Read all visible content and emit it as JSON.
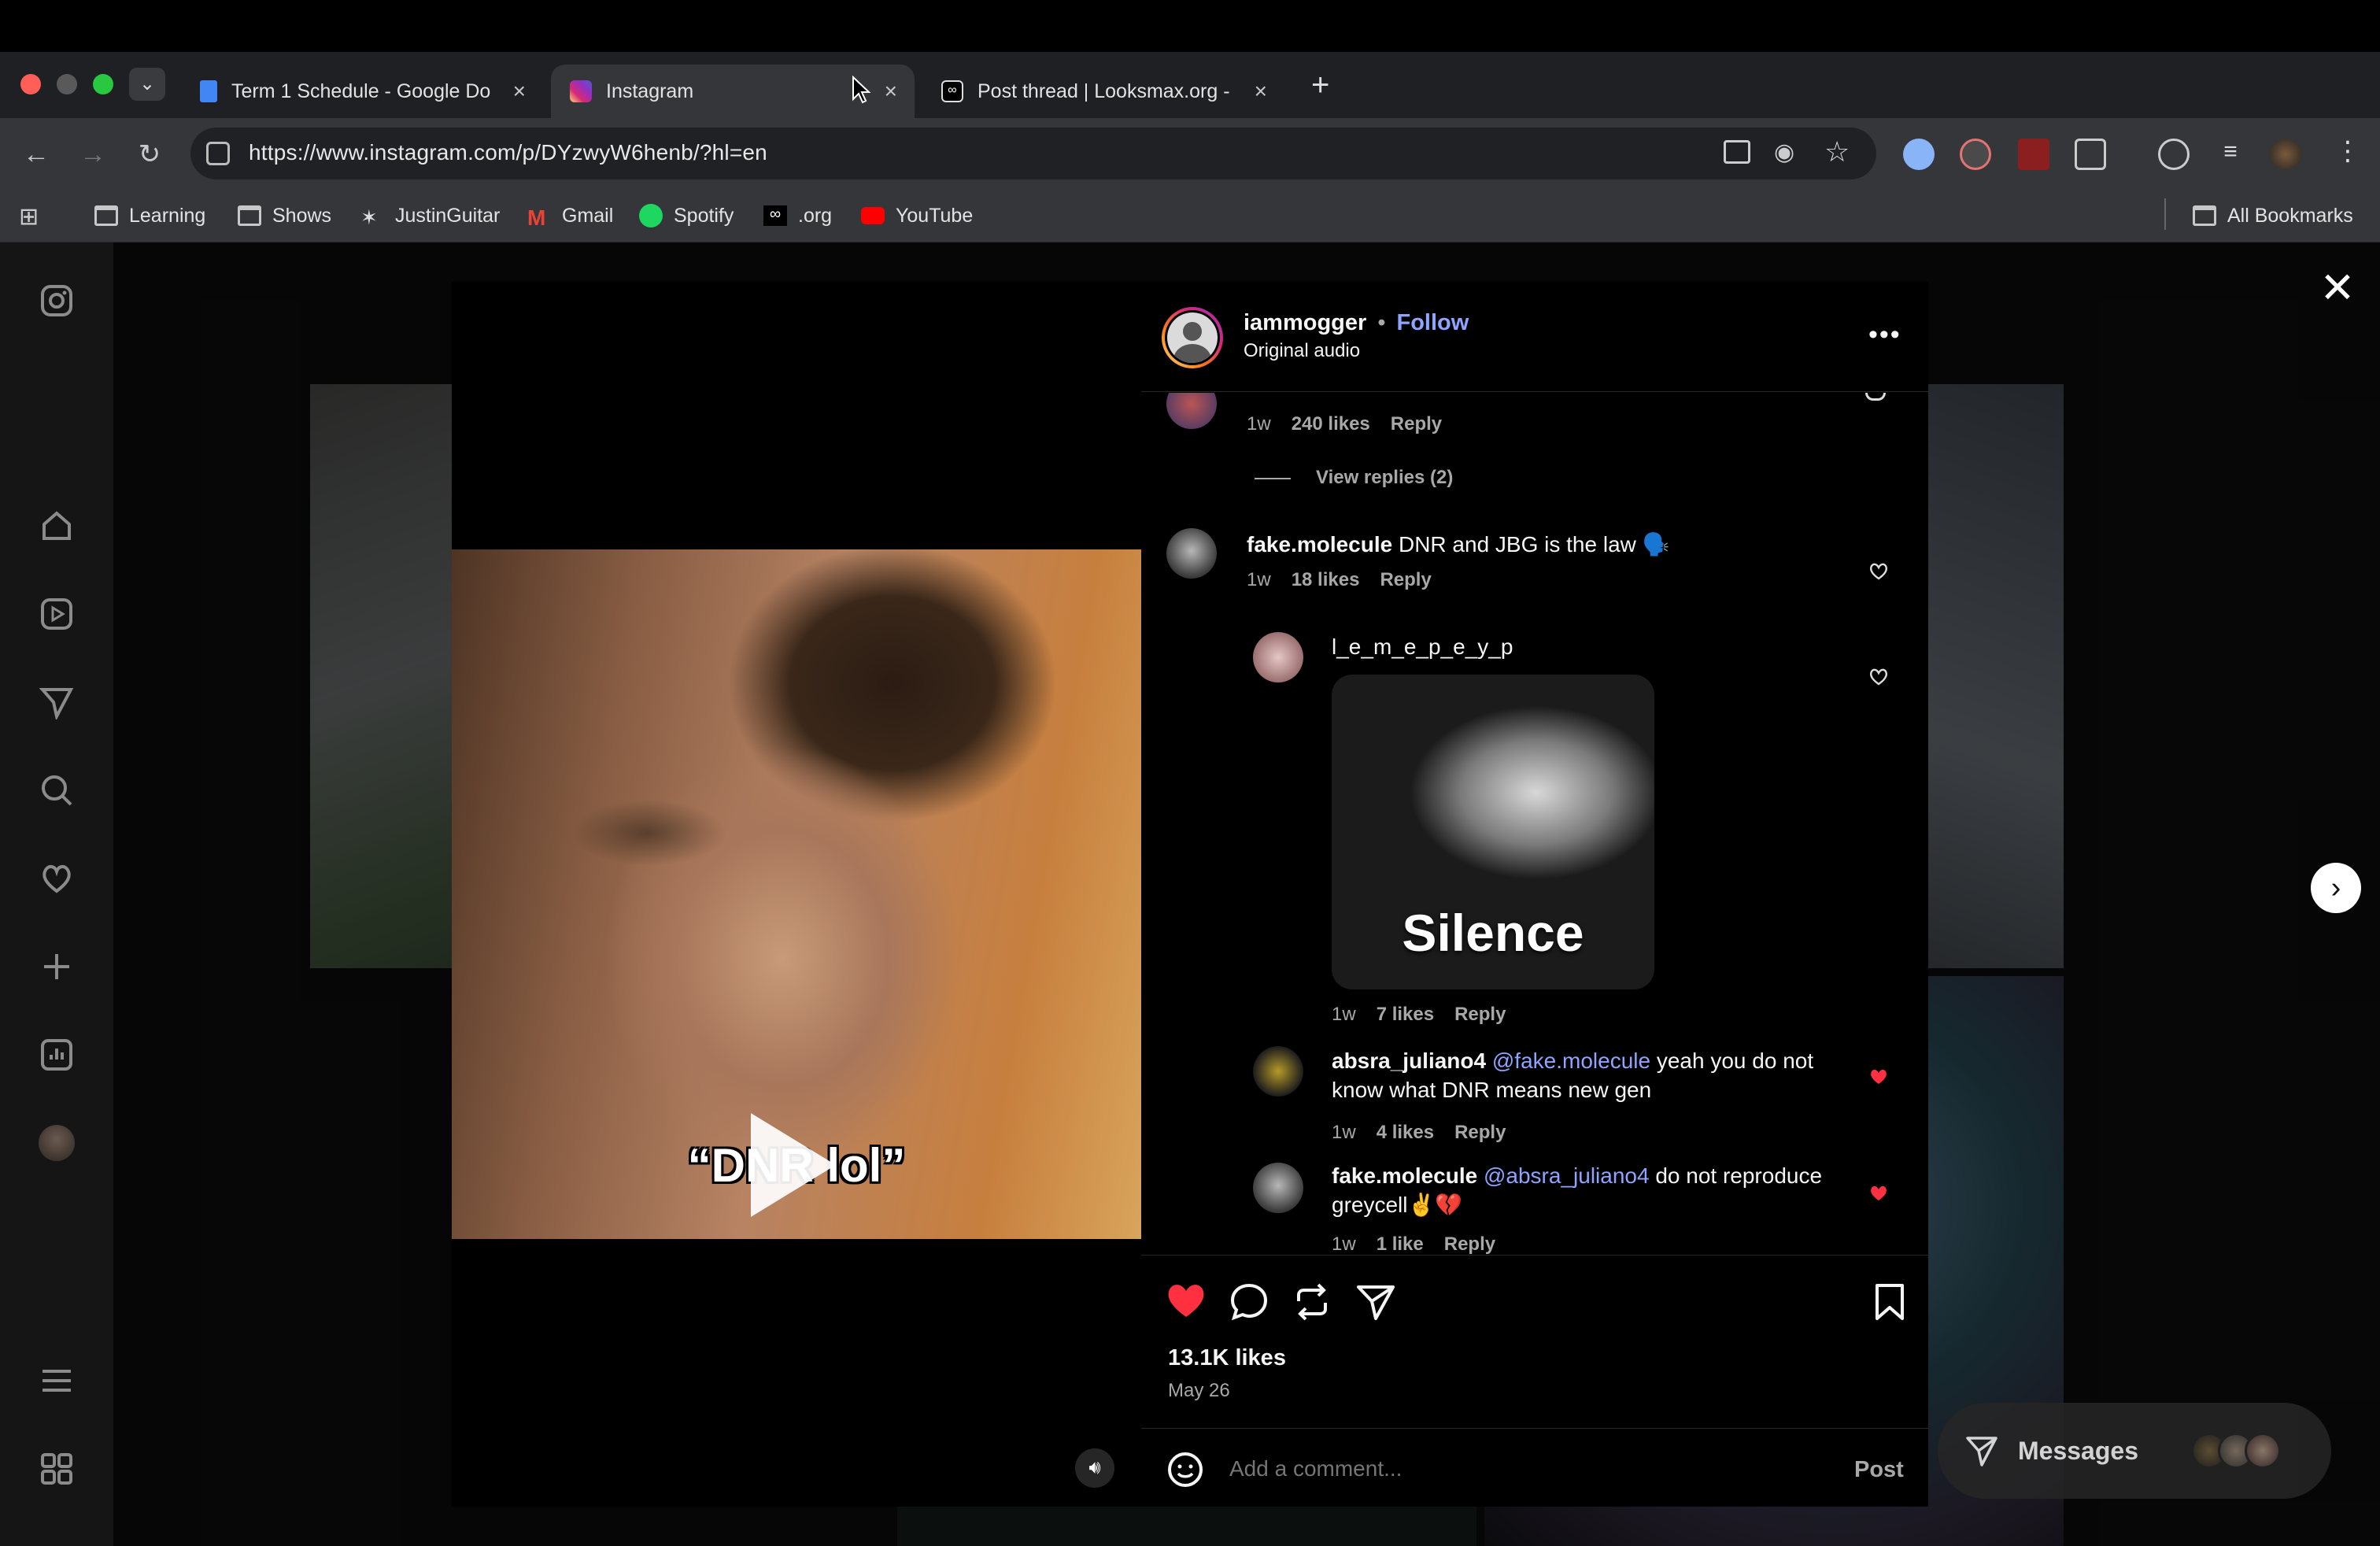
{
  "browser": {
    "tabs": [
      {
        "title": "Term 1 Schedule - Google Do",
        "favicon": "google-docs-icon"
      },
      {
        "title": "Instagram",
        "favicon": "instagram-icon",
        "active": true
      },
      {
        "title": "Post thread | Looksmax.org -",
        "favicon": "looksmax-icon"
      }
    ],
    "url": "https://www.instagram.com/p/DYzwyW6henb/?hl=en",
    "bookmarks": [
      {
        "label": "Learning",
        "icon": "folder-icon"
      },
      {
        "label": "Shows",
        "icon": "folder-icon"
      },
      {
        "label": "JustinGuitar",
        "icon": "justinguitar-icon"
      },
      {
        "label": "Gmail",
        "icon": "gmail-icon"
      },
      {
        "label": "Spotify",
        "icon": "spotify-icon"
      },
      {
        "label": ".org",
        "icon": "looksmax-icon"
      },
      {
        "label": "YouTube",
        "icon": "youtube-icon"
      }
    ],
    "all_bookmarks": "All Bookmarks"
  },
  "post": {
    "author": "iammogger",
    "follow_label": "Follow",
    "audio": "Original audio",
    "video_caption": "“DNR lol”",
    "likes": "13.1K likes",
    "date": "May 26",
    "add_comment_placeholder": "Add a comment...",
    "post_label": "Post"
  },
  "comments": {
    "partial": {
      "age": "1w",
      "likes": "240 likes",
      "reply": "Reply"
    },
    "view_replies": "View replies (2)",
    "c1": {
      "user": "fake.molecule",
      "text": "DNR and JBG is the law 🗣️",
      "age": "1w",
      "likes": "18 likes",
      "reply": "Reply"
    },
    "r1": {
      "user": "l_e_m_e_p_e_y_p",
      "image_text": "Silence",
      "age": "1w",
      "likes": "7 likes",
      "reply": "Reply"
    },
    "r2": {
      "user": "absra_juliano4",
      "mention": "@fake.molecule",
      "text": "yeah you do not know what DNR means new gen",
      "age": "1w",
      "likes": "4 likes",
      "reply": "Reply"
    },
    "r3": {
      "user": "fake.molecule",
      "mention": "@absra_juliano4",
      "text": "do not reproduce greycell✌️💔",
      "age": "1w",
      "likes": "1 like",
      "reply": "Reply"
    }
  },
  "messages": {
    "label": "Messages"
  },
  "colors": {
    "like_red": "#ff3040",
    "link_blue": "#8fa3ff",
    "follow_blue": "#0095f6"
  }
}
